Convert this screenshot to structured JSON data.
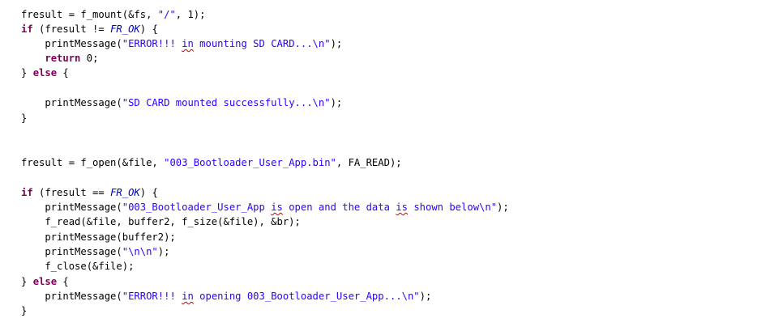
{
  "code": {
    "l01": {
      "fresult": "fresult = f_mount(&fs, ",
      "str": "\"/\"",
      "rest": ", 1);"
    },
    "l02": {
      "kw": "if",
      "pre": " (fresult != ",
      "const": "FR_OK",
      "post": ") {"
    },
    "l03": {
      "fn": "    printMessage(",
      "s1": "\"ERROR!!! ",
      "sq": "in",
      "s2": " mounting SD CARD...\\n\"",
      "post": ");"
    },
    "l04": {
      "indent": "    ",
      "kw": "return",
      "post": " 0;"
    },
    "l05": {
      "pre": "} ",
      "kw": "else",
      "post": " {"
    },
    "l07": {
      "fn": "    printMessage(",
      "str": "\"SD CARD mounted successfully...\\n\"",
      "post": ");"
    },
    "l08": {
      "text": "}"
    },
    "l11": {
      "pre": "fresult = f_open(&file, ",
      "str": "\"003_Bootloader_User_App.bin\"",
      "post": ", FA_READ);"
    },
    "l13": {
      "kw": "if",
      "pre": " (fresult == ",
      "const": "FR_OK",
      "post": ") {"
    },
    "l14": {
      "fn": "    printMessage(",
      "s1": "\"003_Bootloader_User_App ",
      "sq1": "is",
      "s2": " open and the data ",
      "sq2": "is",
      "s3": " shown below\\n\"",
      "post": ");"
    },
    "l15": {
      "text": "    f_read(&file, buffer2, f_size(&file), &br);"
    },
    "l16": {
      "text": "    printMessage(buffer2);"
    },
    "l17": {
      "fn": "    printMessage(",
      "str": "\"\\n\\n\"",
      "post": ");"
    },
    "l18": {
      "text": "    f_close(&file);"
    },
    "l19": {
      "pre": "} ",
      "kw": "else",
      "post": " {"
    },
    "l20": {
      "fn": "    printMessage(",
      "s1": "\"ERROR!!! ",
      "sq": "in",
      "s2": " opening 003_Bootloader_User_App...\\n\"",
      "post": ");"
    },
    "l21": {
      "text": "}"
    }
  },
  "colors": {
    "keyword": "#7f0055",
    "string": "#2a00ff",
    "constant": "#0000c0",
    "spell_error": "#d40000"
  }
}
